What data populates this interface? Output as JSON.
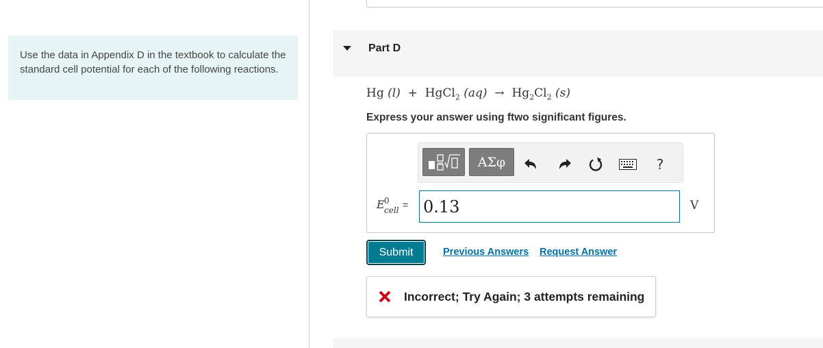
{
  "intro": {
    "text": "Use the data in Appendix D in the textbook to calculate the standard cell potential for each of the following reactions."
  },
  "part": {
    "title": "Part D"
  },
  "equation": {
    "lhs1": "Hg",
    "lhs1_state": "(l)",
    "plus": "+",
    "lhs2": "HgCl",
    "lhs2_sub": "2",
    "lhs2_state": "(aq)",
    "arrow": "→",
    "rhs_a": "Hg",
    "rhs_sub1": "2",
    "rhs_b": "Cl",
    "rhs_sub2": "2",
    "rhs_state": "(s)"
  },
  "instruction": "Express your answer using ftwo significant figures.",
  "toolbar": {
    "templates_icon": "templates-icon",
    "greek_label": "ΑΣφ",
    "undo_icon": "undo-icon",
    "redo_icon": "redo-icon",
    "reset_icon": "reset-icon",
    "keyboard_icon": "keyboard-icon",
    "help_label": "?"
  },
  "answer": {
    "label_main": "E",
    "label_sup": "0",
    "label_sub": "cell",
    "label_eq": "=",
    "value": "0.13",
    "unit": "V"
  },
  "actions": {
    "submit_label": "Submit",
    "previous_answers_label": "Previous Answers",
    "request_answer_label": "Request Answer"
  },
  "feedback": {
    "icon": "incorrect-x-icon",
    "text": "Incorrect; Try Again; 3 attempts remaining"
  },
  "colors": {
    "accent": "#007c92",
    "link": "#0070a0",
    "error": "#d0021b",
    "intro_bg": "#e6f4f5"
  }
}
